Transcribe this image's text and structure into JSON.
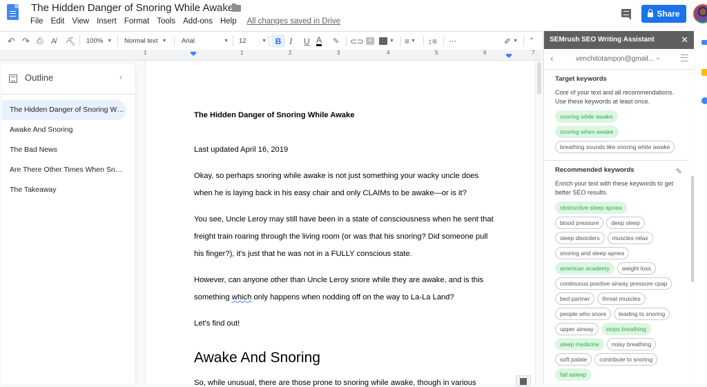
{
  "app": {
    "doc_title": "The Hidden Danger of Snoring While Awake",
    "menu": [
      "File",
      "Edit",
      "View",
      "Insert",
      "Format",
      "Tools",
      "Add-ons",
      "Help"
    ],
    "save_status": "All changes saved in Drive",
    "share_label": "Share",
    "colors": {
      "accent": "#1a73e8",
      "keyword_used_bg": "#ddf5e2",
      "keyword_used_text": "#2cb149",
      "panel_header": "#5f5f5f"
    }
  },
  "toolbar": {
    "zoom": "100%",
    "style": "Normal text",
    "font": "Arial",
    "size": "12",
    "bold": "B",
    "italic": "I",
    "underline": "U",
    "text_color": "A",
    "more": "⋯"
  },
  "ruler": {
    "ticks": [
      "1",
      "1",
      "2",
      "3",
      "4",
      "5",
      "6",
      "7"
    ]
  },
  "outline": {
    "title": "Outline",
    "items": [
      "The Hidden Danger of Snoring While Awake",
      "Awake And Snoring",
      "The Bad News",
      "Are There Other Times When Snoring Happens",
      "The Takeaway"
    ],
    "active_index": 0
  },
  "document": {
    "title": "The Hidden Danger of Snoring While Awake",
    "updated": "Last updated April 16, 2019",
    "p1_l1": "Okay, so perhaps snoring while awake is not just something your wacky uncle does",
    "p1_l2": "when he is laying back in his easy chair and only CLAIMs to be awake—or is it?",
    "p2_l1": "You see, Uncle Leroy may still have been in a state of consciousness when he sent that",
    "p2_l2": "freight train roaring through the living room (or was that his snoring? Did someone pull",
    "p2_l3": "his finger?), it's just that he was not in a FULLY conscious state.",
    "p3_l1": "However, can anyone other than Uncle Leroy snore while they are awake, and is this",
    "p3_l2_a": "something ",
    "p3_l2_b": "which",
    "p3_l2_c": " only happens when nodding off on the way to La-La Land?",
    "p4": "Let's find out!",
    "h2": "Awake And Snoring",
    "p5_partial": "So, while unusual, there are those prone to snoring while awake, though in various"
  },
  "seo_panel": {
    "title": "SEMrush SEO Writing Assistant",
    "account": "venchitotampon@gmail...",
    "target": {
      "title": "Target keywords",
      "desc": "Core of your text and all recommendations. Use these keywords at least once.",
      "keywords": [
        {
          "text": "snoring while awake",
          "used": true
        },
        {
          "text": "snoring when awake",
          "used": true
        },
        {
          "text": "breathing sounds like snoring while awake",
          "used": false
        }
      ]
    },
    "recommended": {
      "title": "Recommended keywords",
      "desc": "Enrich your text with these keywords to get better SEO results.",
      "keywords": [
        {
          "text": "obstructive sleep apnea",
          "used": true
        },
        {
          "text": "blood pressure",
          "used": false
        },
        {
          "text": "deep sleep",
          "used": false
        },
        {
          "text": "sleep disorders",
          "used": false
        },
        {
          "text": "muscles relax",
          "used": false
        },
        {
          "text": "snoring and sleep apnea",
          "used": false
        },
        {
          "text": "american academy",
          "used": true
        },
        {
          "text": "weight loss",
          "used": false
        },
        {
          "text": "continuous positive airway pressure cpap",
          "used": false
        },
        {
          "text": "bed partner",
          "used": false
        },
        {
          "text": "throat muscles",
          "used": false
        },
        {
          "text": "people who snore",
          "used": false
        },
        {
          "text": "leading to snoring",
          "used": false
        },
        {
          "text": "upper airway",
          "used": false
        },
        {
          "text": "stops breathing",
          "used": true
        },
        {
          "text": "sleep medicine",
          "used": true
        },
        {
          "text": "noisy breathing",
          "used": false
        },
        {
          "text": "soft palate",
          "used": false
        },
        {
          "text": "contribute to snoring",
          "used": false
        },
        {
          "text": "fall asleep",
          "used": true
        }
      ]
    }
  }
}
